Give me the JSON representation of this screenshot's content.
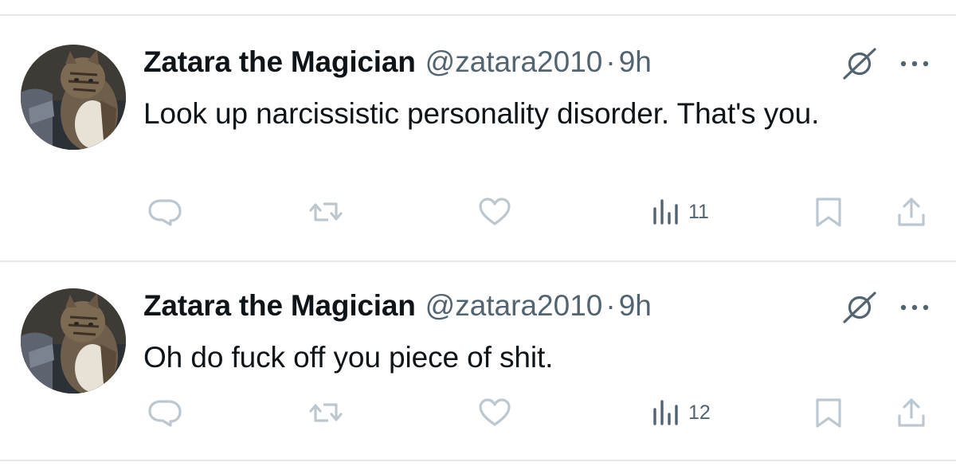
{
  "posts": [
    {
      "author_name": "Zatara the Magician",
      "handle": "@zatara2010",
      "separator": "·",
      "time": "9h",
      "text": "Look up narcissistic personality disorder. That's you.",
      "views": "11"
    },
    {
      "author_name": "Zatara the Magician",
      "handle": "@zatara2010",
      "separator": "·",
      "time": "9h",
      "text": "Oh do fuck off you piece of shit.",
      "views": "12"
    }
  ],
  "icons": {
    "grok": "grok-icon",
    "more": "more-icon",
    "reply": "reply-icon",
    "repost": "repost-icon",
    "like": "like-icon",
    "views": "views-icon",
    "bookmark": "bookmark-icon",
    "share": "share-icon"
  },
  "colors": {
    "text": "#0f1419",
    "secondary": "#536471",
    "action_icons": "#bdc7cf",
    "divider": "#e6e9ec"
  }
}
